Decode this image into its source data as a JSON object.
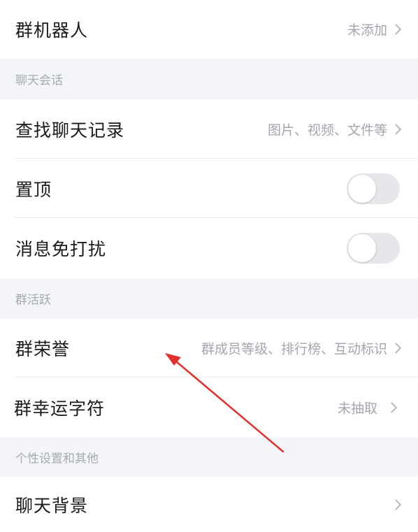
{
  "rows": {
    "group_bot": {
      "label": "群机器人",
      "value": "未添加"
    },
    "search_history": {
      "label": "查找聊天记录",
      "value": "图片、视频、文件等"
    },
    "pin_top": {
      "label": "置顶",
      "enabled": false
    },
    "mute": {
      "label": "消息免打扰",
      "enabled": false
    },
    "group_honor": {
      "label": "群荣誉",
      "value": "群成员等级、排行榜、互动标识"
    },
    "lucky_char": {
      "label": "群幸运字符",
      "value": "未抽取"
    },
    "chat_background": {
      "label": "聊天背景",
      "value": ""
    }
  },
  "sections": {
    "chat_session": "聊天会话",
    "group_activity": "群活跃",
    "personal_other": "个性设置和其他"
  },
  "colors": {
    "background": "#f4f5f9",
    "row": "#ffffff",
    "annotation_arrow": "#e2302a",
    "toggle_off": "#e6e7eb"
  }
}
